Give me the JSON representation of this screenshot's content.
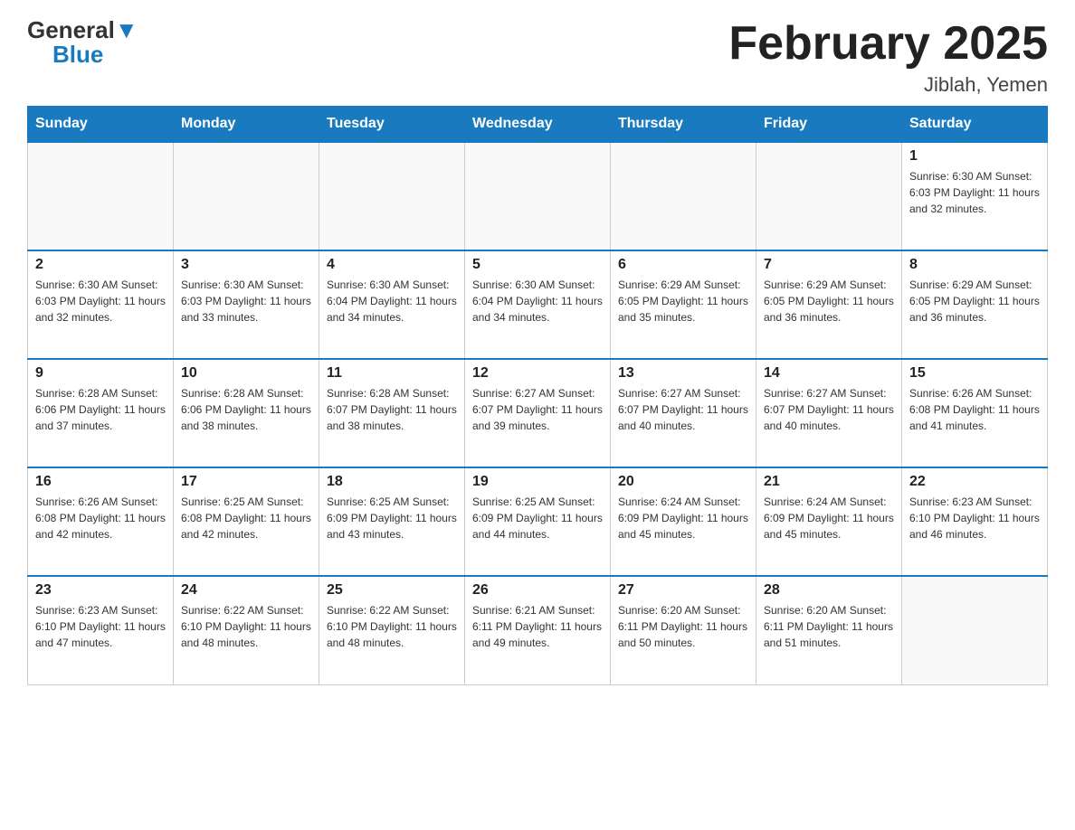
{
  "logo": {
    "general": "General",
    "blue": "Blue"
  },
  "title": {
    "month": "February 2025",
    "location": "Jiblah, Yemen"
  },
  "days_header": [
    "Sunday",
    "Monday",
    "Tuesday",
    "Wednesday",
    "Thursday",
    "Friday",
    "Saturday"
  ],
  "weeks": [
    [
      {
        "day": "",
        "info": ""
      },
      {
        "day": "",
        "info": ""
      },
      {
        "day": "",
        "info": ""
      },
      {
        "day": "",
        "info": ""
      },
      {
        "day": "",
        "info": ""
      },
      {
        "day": "",
        "info": ""
      },
      {
        "day": "1",
        "info": "Sunrise: 6:30 AM\nSunset: 6:03 PM\nDaylight: 11 hours\nand 32 minutes."
      }
    ],
    [
      {
        "day": "2",
        "info": "Sunrise: 6:30 AM\nSunset: 6:03 PM\nDaylight: 11 hours\nand 32 minutes."
      },
      {
        "day": "3",
        "info": "Sunrise: 6:30 AM\nSunset: 6:03 PM\nDaylight: 11 hours\nand 33 minutes."
      },
      {
        "day": "4",
        "info": "Sunrise: 6:30 AM\nSunset: 6:04 PM\nDaylight: 11 hours\nand 34 minutes."
      },
      {
        "day": "5",
        "info": "Sunrise: 6:30 AM\nSunset: 6:04 PM\nDaylight: 11 hours\nand 34 minutes."
      },
      {
        "day": "6",
        "info": "Sunrise: 6:29 AM\nSunset: 6:05 PM\nDaylight: 11 hours\nand 35 minutes."
      },
      {
        "day": "7",
        "info": "Sunrise: 6:29 AM\nSunset: 6:05 PM\nDaylight: 11 hours\nand 36 minutes."
      },
      {
        "day": "8",
        "info": "Sunrise: 6:29 AM\nSunset: 6:05 PM\nDaylight: 11 hours\nand 36 minutes."
      }
    ],
    [
      {
        "day": "9",
        "info": "Sunrise: 6:28 AM\nSunset: 6:06 PM\nDaylight: 11 hours\nand 37 minutes."
      },
      {
        "day": "10",
        "info": "Sunrise: 6:28 AM\nSunset: 6:06 PM\nDaylight: 11 hours\nand 38 minutes."
      },
      {
        "day": "11",
        "info": "Sunrise: 6:28 AM\nSunset: 6:07 PM\nDaylight: 11 hours\nand 38 minutes."
      },
      {
        "day": "12",
        "info": "Sunrise: 6:27 AM\nSunset: 6:07 PM\nDaylight: 11 hours\nand 39 minutes."
      },
      {
        "day": "13",
        "info": "Sunrise: 6:27 AM\nSunset: 6:07 PM\nDaylight: 11 hours\nand 40 minutes."
      },
      {
        "day": "14",
        "info": "Sunrise: 6:27 AM\nSunset: 6:07 PM\nDaylight: 11 hours\nand 40 minutes."
      },
      {
        "day": "15",
        "info": "Sunrise: 6:26 AM\nSunset: 6:08 PM\nDaylight: 11 hours\nand 41 minutes."
      }
    ],
    [
      {
        "day": "16",
        "info": "Sunrise: 6:26 AM\nSunset: 6:08 PM\nDaylight: 11 hours\nand 42 minutes."
      },
      {
        "day": "17",
        "info": "Sunrise: 6:25 AM\nSunset: 6:08 PM\nDaylight: 11 hours\nand 42 minutes."
      },
      {
        "day": "18",
        "info": "Sunrise: 6:25 AM\nSunset: 6:09 PM\nDaylight: 11 hours\nand 43 minutes."
      },
      {
        "day": "19",
        "info": "Sunrise: 6:25 AM\nSunset: 6:09 PM\nDaylight: 11 hours\nand 44 minutes."
      },
      {
        "day": "20",
        "info": "Sunrise: 6:24 AM\nSunset: 6:09 PM\nDaylight: 11 hours\nand 45 minutes."
      },
      {
        "day": "21",
        "info": "Sunrise: 6:24 AM\nSunset: 6:09 PM\nDaylight: 11 hours\nand 45 minutes."
      },
      {
        "day": "22",
        "info": "Sunrise: 6:23 AM\nSunset: 6:10 PM\nDaylight: 11 hours\nand 46 minutes."
      }
    ],
    [
      {
        "day": "23",
        "info": "Sunrise: 6:23 AM\nSunset: 6:10 PM\nDaylight: 11 hours\nand 47 minutes."
      },
      {
        "day": "24",
        "info": "Sunrise: 6:22 AM\nSunset: 6:10 PM\nDaylight: 11 hours\nand 48 minutes."
      },
      {
        "day": "25",
        "info": "Sunrise: 6:22 AM\nSunset: 6:10 PM\nDaylight: 11 hours\nand 48 minutes."
      },
      {
        "day": "26",
        "info": "Sunrise: 6:21 AM\nSunset: 6:11 PM\nDaylight: 11 hours\nand 49 minutes."
      },
      {
        "day": "27",
        "info": "Sunrise: 6:20 AM\nSunset: 6:11 PM\nDaylight: 11 hours\nand 50 minutes."
      },
      {
        "day": "28",
        "info": "Sunrise: 6:20 AM\nSunset: 6:11 PM\nDaylight: 11 hours\nand 51 minutes."
      },
      {
        "day": "",
        "info": ""
      }
    ]
  ]
}
